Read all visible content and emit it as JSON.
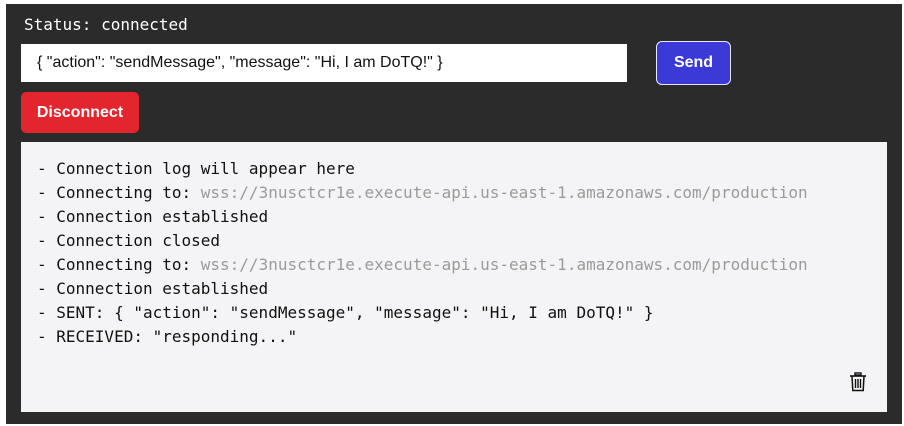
{
  "status": {
    "text": "Status: connected"
  },
  "composer": {
    "message_value": "{ \"action\": \"sendMessage\", \"message\": \"Hi, I am DoTQ!\" }",
    "send_label": "Send",
    "send_color": "#3b3ad6"
  },
  "controls": {
    "disconnect_label": "Disconnect",
    "disconnect_color": "#e3252d"
  },
  "log": {
    "entries": [
      {
        "text": "- Connection log will appear here",
        "url": ""
      },
      {
        "text": "- Connecting to: ",
        "url": "wss://3nusctcr1e.execute-api.us-east-1.amazonaws.com/production"
      },
      {
        "text": "- Connection established",
        "url": ""
      },
      {
        "text": "- Connection closed",
        "url": ""
      },
      {
        "text": "- Connecting to: ",
        "url": "wss://3nusctcr1e.execute-api.us-east-1.amazonaws.com/production"
      },
      {
        "text": "- Connection established",
        "url": ""
      },
      {
        "text": "- SENT: { \"action\": \"sendMessage\", \"message\": \"Hi, I am DoTQ!\" }",
        "url": ""
      },
      {
        "text": "- RECEIVED: \"responding...\"",
        "url": ""
      }
    ],
    "clear_icon": "trash-icon"
  }
}
